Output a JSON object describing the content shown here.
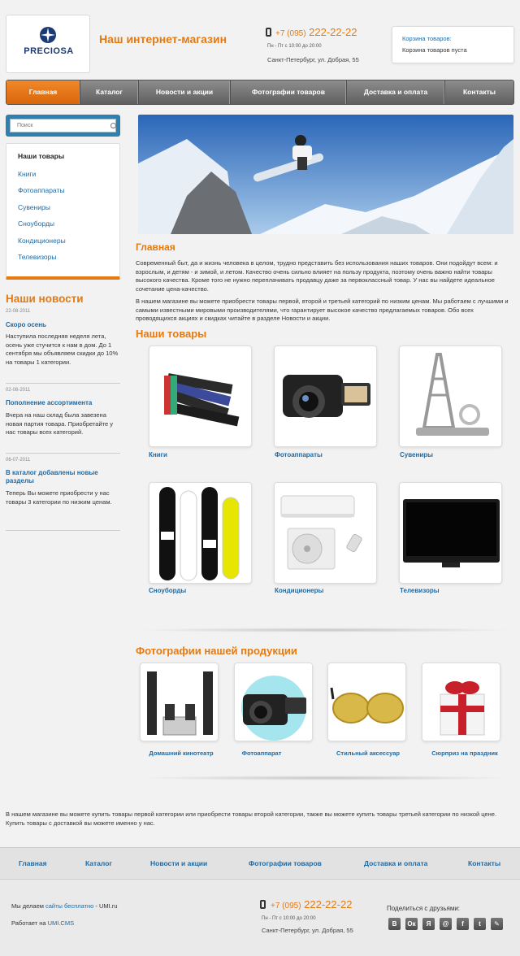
{
  "header": {
    "logo_text": "PRECIOSA",
    "site_title": "Наш интернет-магазин",
    "phone_code": "+7 (095)",
    "phone_number": "222-22-22",
    "hours": "Пн - Пт с 10:00 до 20:00",
    "address": "Санкт-Петербург, ул. Добрая, 55",
    "cart_title": "Корзина товаров:",
    "cart_status": "Корзина товаров пуста"
  },
  "nav": {
    "items": [
      "Главная",
      "Каталог",
      "Новости и акции",
      "Фотографии товаров",
      "Доставка и оплата",
      "Контакты"
    ],
    "active": "Главная"
  },
  "search": {
    "placeholder": "Поиск"
  },
  "categories": {
    "title": "Наши товары",
    "items": [
      "Книги",
      "Фотоаппараты",
      "Сувениры",
      "Сноуборды",
      "Кондиционеры",
      "Телевизоры"
    ]
  },
  "news": {
    "title": "Наши новости",
    "items": [
      {
        "date": "22-08-2011",
        "title": "Скоро осень",
        "body": "Наступила последняя неделя лета, осень уже стучится к нам в дом. До 1 сентября мы объявляем скидки до 10% на товары 1 категории."
      },
      {
        "date": "02-08-2011",
        "title": "Пополнение ассортимента",
        "body": "Вчера на наш склад была завезена новая партия товара. Приобретайте у нас товары всех категорий."
      },
      {
        "date": "06-07-2011",
        "title": "В каталог добавлены новые разделы",
        "body": "Теперь Вы можете приобрести у нас товары 3 категории по низким ценам."
      }
    ]
  },
  "main": {
    "heading": "Главная",
    "intro_1": "Современный быт, да и жизнь человека в целом, трудно представить без использования наших товаров. Они подойдут всем: и взрослым, и детям - и зимой, и летом. Качество очень сильно влияет на пользу продукта, поэтому очень важно найти товары высокого качества. Кроме того не нужно переплачивать продавцу даже за первоклассный товар. У нас вы найдете идеальное сочетание цена-качество.",
    "intro_2": "В нашем магазине вы можете приобрести товары первой, второй и третьей категорий по низким ценам. Мы работаем с лучшими и самыми известными мировыми производителями, что гарантирует высокое качество предлагаемых товаров. Обо всех проводящихся акциях и скидках читайте в разделе Новости и акции.",
    "products_title": "Наши товары",
    "products": [
      "Книги",
      "Фотоаппараты",
      "Сувениры",
      "Сноуборды",
      "Кондиционеры",
      "Телевизоры"
    ],
    "photos_title": "Фотографии нашей продукции",
    "photos": [
      "Домашний кинотеатр",
      "Фотоаппарат",
      "Стильный аксессуар",
      "Сюрприз на праздник"
    ],
    "bottom_text": "В нашем магазине вы можете купить товары первой категории или приобрести товары второй категории, также вы можете купить товары третьей категории по низкой цене. Купить товары с доставкой вы можете именно у нас."
  },
  "footer": {
    "nav": [
      "Главная",
      "Каталог",
      "Новости и акции",
      "Фотографии товаров",
      "Доставка и оплата",
      "Контакты"
    ],
    "made_prefix": "Мы делаем ",
    "made_link": "сайты бесплатно",
    "made_suffix": " - UMI.ru",
    "powered_prefix": "Работает на ",
    "powered_link": "UMI.CMS",
    "share_label": "Поделиться с друзьями:",
    "share_buttons": [
      "В",
      "Ок",
      "Я",
      "@",
      "f",
      "t",
      "✎"
    ]
  },
  "colors": {
    "accent": "#e57a10",
    "link": "#1d6aa5",
    "search_bg": "#2f7fb0"
  }
}
